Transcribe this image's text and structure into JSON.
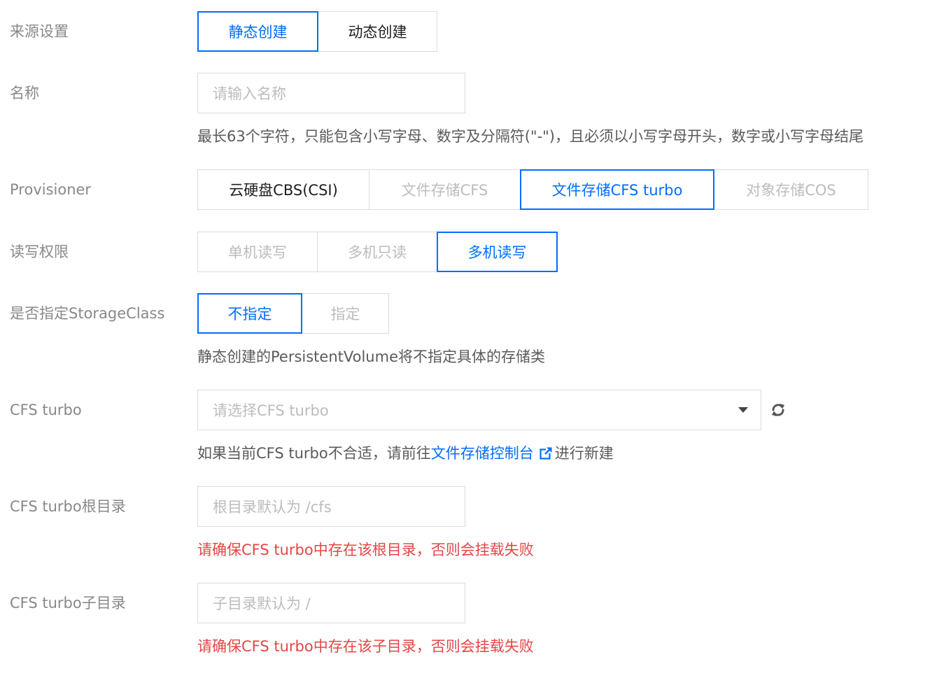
{
  "source": {
    "label": "来源设置",
    "options": [
      "静态创建",
      "动态创建"
    ],
    "selected": "静态创建"
  },
  "name": {
    "label": "名称",
    "placeholder": "请输入名称",
    "help": "最长63个字符，只能包含小写字母、数字及分隔符(\"-\")，且必须以小写字母开头，数字或小写字母结尾"
  },
  "provisioner": {
    "label": "Provisioner",
    "options": [
      "云硬盘CBS(CSI)",
      "文件存储CFS",
      "文件存储CFS turbo",
      "对象存储COS"
    ],
    "selected": "文件存储CFS turbo"
  },
  "access": {
    "label": "读写权限",
    "options": [
      "单机读写",
      "多机只读",
      "多机读写"
    ],
    "selected": "多机读写"
  },
  "storage_class": {
    "label": "是否指定StorageClass",
    "options": [
      "不指定",
      "指定"
    ],
    "selected": "不指定",
    "help": "静态创建的PersistentVolume将不指定具体的存储类"
  },
  "cfs_turbo": {
    "label": "CFS turbo",
    "placeholder": "请选择CFS turbo",
    "help_prefix": "如果当前CFS turbo不合适，请前往",
    "help_link": "文件存储控制台",
    "help_suffix": "进行新建",
    "icons": {
      "dropdown": "chevron-down-icon",
      "refresh": "refresh-icon",
      "external": "external-link-icon"
    }
  },
  "root_dir": {
    "label": "CFS turbo根目录",
    "placeholder": "根目录默认为 /cfs",
    "error": "请确保CFS turbo中存在该根目录，否则会挂载失败"
  },
  "sub_dir": {
    "label": "CFS turbo子目录",
    "placeholder": "子目录默认为 /",
    "error": "请确保CFS turbo中存在该子目录，否则会挂载失败"
  },
  "colors": {
    "accent": "#006eff",
    "error": "#e54545",
    "label": "#888888",
    "border": "#dcdcdc",
    "placeholder": "#bcbcbc"
  }
}
